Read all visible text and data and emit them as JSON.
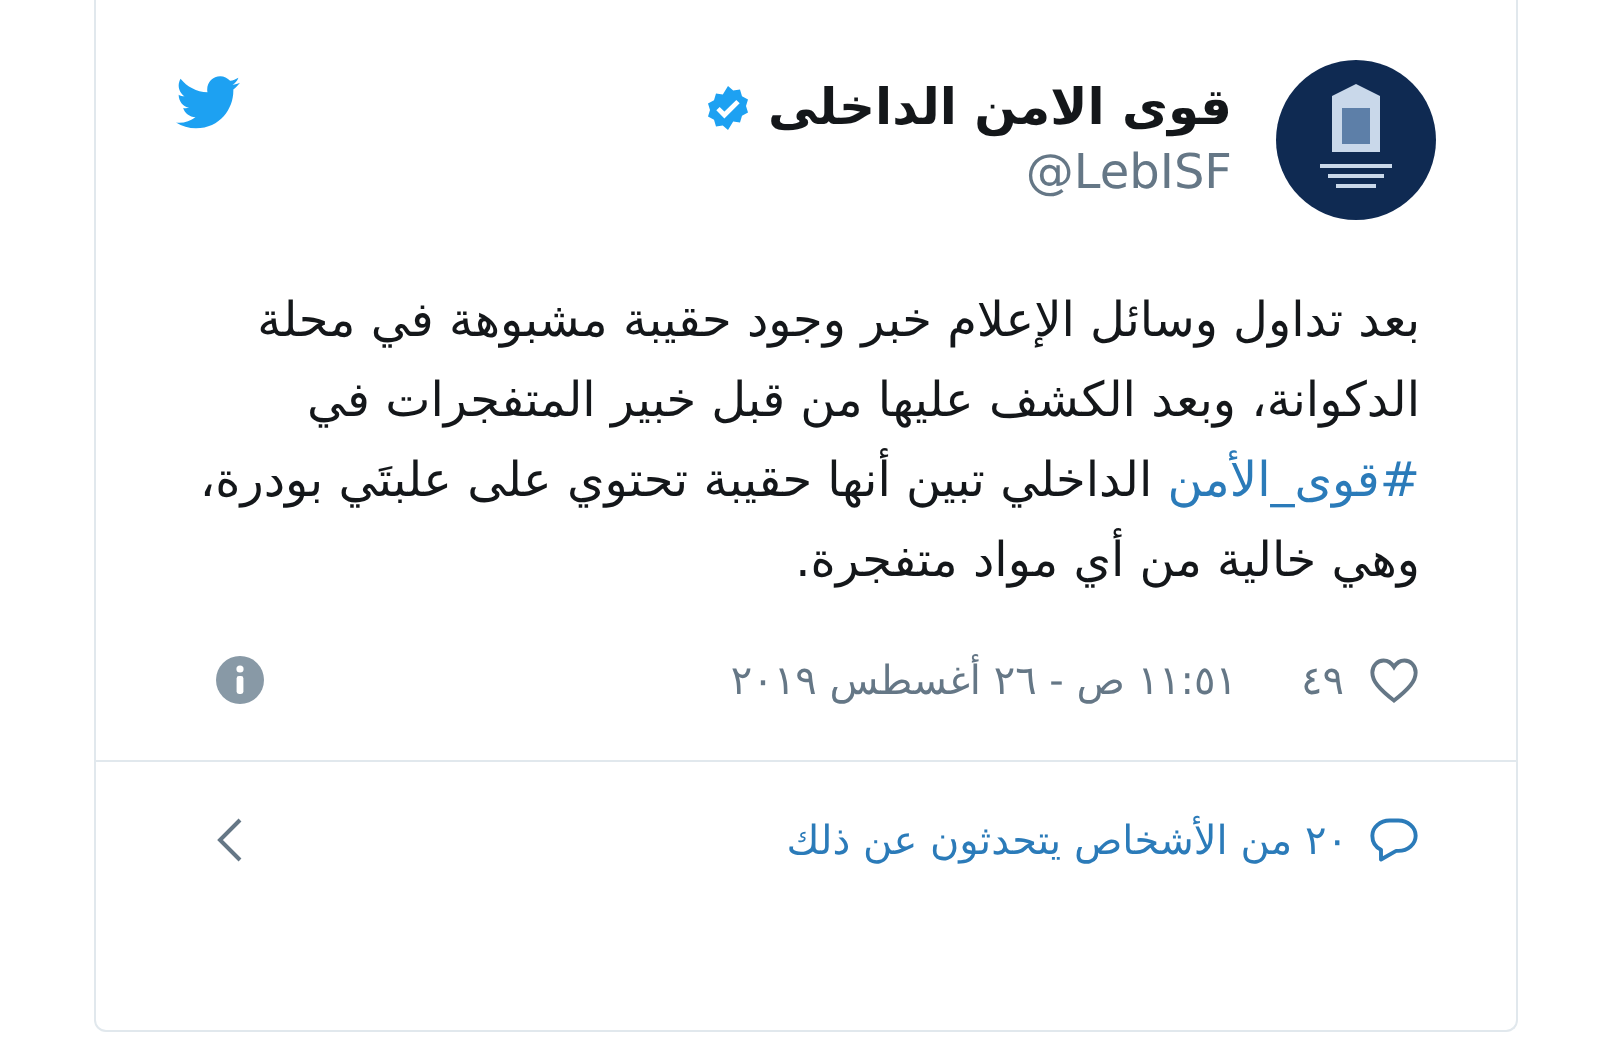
{
  "author": {
    "name": "قوى الامن الداخلى",
    "verified": true,
    "handle": "@LebISF"
  },
  "body": [
    {
      "kind": "text",
      "text": "بعد تداول وسائل الإعلام خبر وجود حقيبة مشبوهة في محلة الدكوانة، وبعد الكشف عليها من قبل خبير المتفجرات في "
    },
    {
      "kind": "hashtag",
      "text": "#قوى_الأمن"
    },
    {
      "kind": "text",
      "text": " الداخلي تبين أنها حقيبة تحتوي على علبتَي بودرة، وهي خالية من أي مواد متفجرة."
    }
  ],
  "likes": "٤٩",
  "timestamp": "١١:٥١ ص - ٢٦ أغسطس ٢٠١٩",
  "conversation": "٢٠ من الأشخاص يتحدثون عن ذلك"
}
